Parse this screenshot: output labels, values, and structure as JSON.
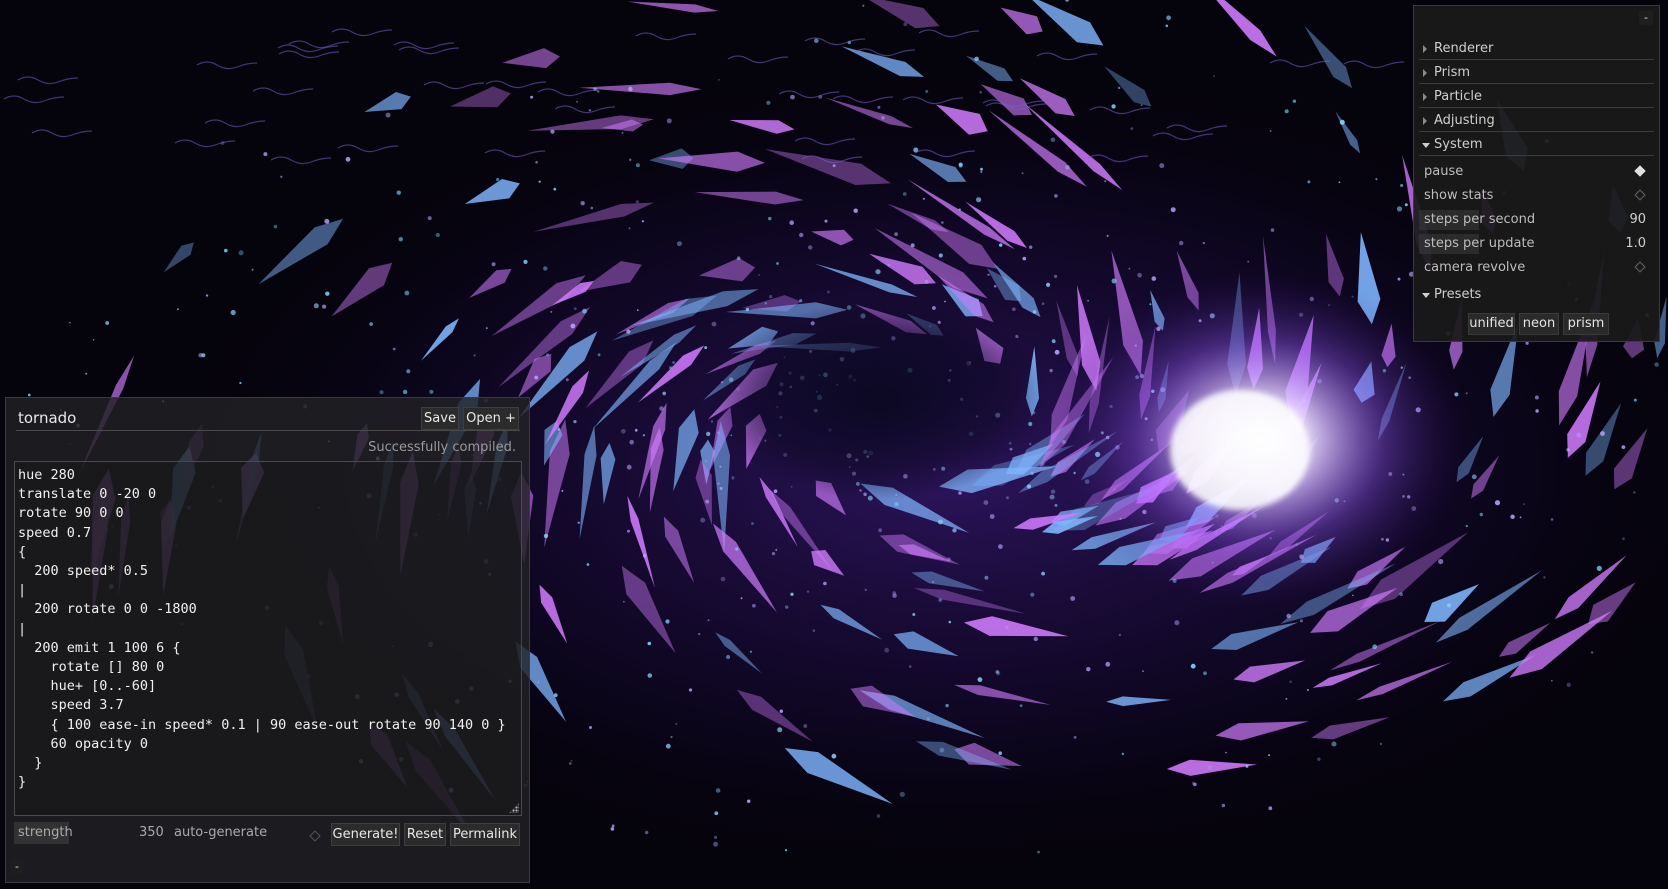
{
  "settings": {
    "collapse_label": "-",
    "folders": {
      "renderer": "Renderer",
      "prism": "Prism",
      "particle": "Particle",
      "adjusting": "Adjusting",
      "system": "System",
      "presets": "Presets"
    },
    "system": {
      "pause": {
        "label": "pause",
        "checked": true
      },
      "show_stats": {
        "label": "show stats",
        "checked": false
      },
      "steps_per_second": {
        "label": "steps per second",
        "value": "90"
      },
      "steps_per_update": {
        "label": "steps per update",
        "value": "1.0"
      },
      "camera_revolve": {
        "label": "camera revolve",
        "checked": false
      }
    },
    "presets": [
      "unified",
      "neon",
      "prism"
    ]
  },
  "editor": {
    "program_name": "tornado",
    "save_label": "Save",
    "open_label": "Open +",
    "status": "Successfully compiled.",
    "code": "hue 280\ntranslate 0 -20 0\nrotate 90 0 0\nspeed 0.7\n{\n  200 speed* 0.5\n|\n  200 rotate 0 0 -1800\n|\n  200 emit 1 100 6 {\n    rotate [] 80 0\n    hue+ [0..-60]\n    speed 3.7\n    { 100 ease-in speed* 0.1 | 90 ease-out rotate 90 140 0 }\n    60 opacity 0\n  }\n}",
    "strength_label": "strength",
    "strength_value": "350",
    "autogen_label": "auto-generate",
    "autogen_checked": false,
    "generate_label": "Generate!",
    "reset_label": "Reset",
    "permalink_label": "Permalink",
    "collapse_label": "-"
  },
  "colors": {
    "accent_pink": "#d27cff",
    "accent_blue": "#7fb6ff",
    "background": "#05030c"
  }
}
